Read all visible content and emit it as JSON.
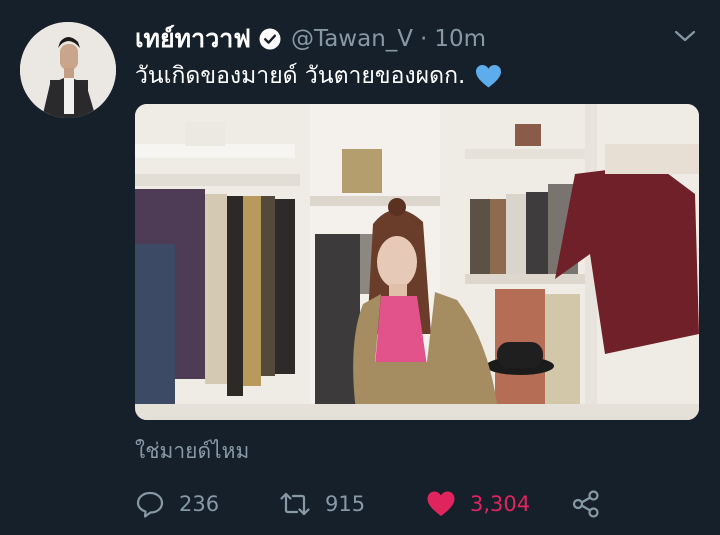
{
  "tweet": {
    "display_name": "เทย์ทาวาฟ",
    "handle": "@Tawan_V",
    "separator": "·",
    "time": "10m",
    "text": "วันเกิดของมายด์ วันตายของผดก.",
    "text_emoji": "blue-heart-emoji",
    "verified": true
  },
  "reply_line": "ใช่มายด์ไหม",
  "actions": {
    "reply_count": "236",
    "retweet_count": "915",
    "like_count": "3,304",
    "liked": true
  },
  "colors": {
    "background": "#15202b",
    "secondary_text": "#8899a6",
    "like": "#e0245e",
    "emoji_heart": "#5dadec"
  }
}
